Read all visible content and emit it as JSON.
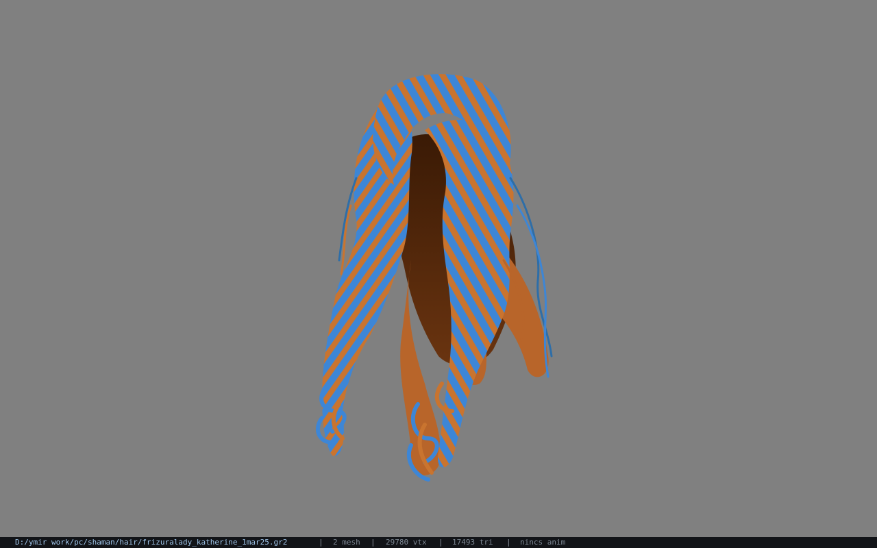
{
  "viewer": {
    "background_color": "#808080",
    "model_colors": {
      "strand_blue": "#3d86d6",
      "strand_orange": "#c9742f",
      "inner_brown": "#4a2208"
    }
  },
  "status": {
    "file_path": "D:/ymir work/pc/shaman/hair/frizuralady_katherine_1mar25.gr2",
    "separator": "|",
    "mesh": "2 mesh",
    "vertices": "29780 vtx",
    "triangles": "17493 tri",
    "animation": "nincs anim"
  }
}
